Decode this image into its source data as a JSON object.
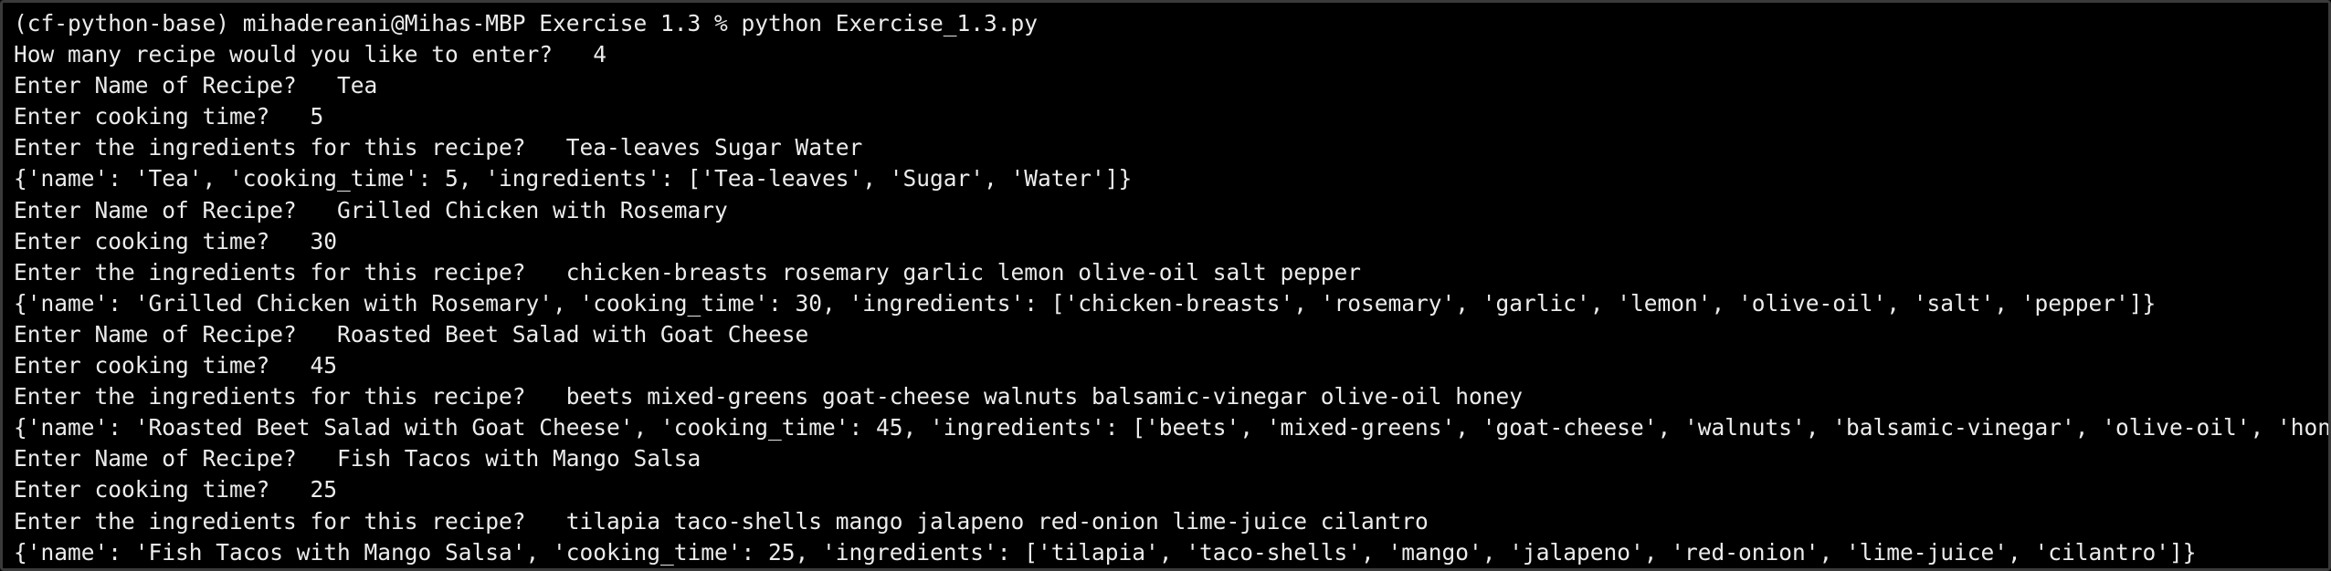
{
  "terminal": {
    "colors": {
      "background": "#000000",
      "foreground": "#ececec",
      "border": "#3a3a3a"
    },
    "lines": [
      "(cf-python-base) mihadereani@Mihas-MBP Exercise 1.3 % python Exercise_1.3.py",
      "How many recipe would you like to enter?   4",
      "Enter Name of Recipe?   Tea",
      "Enter cooking time?   5",
      "Enter the ingredients for this recipe?   Tea-leaves Sugar Water",
      "{'name': 'Tea', 'cooking_time': 5, 'ingredients': ['Tea-leaves', 'Sugar', 'Water']}",
      "Enter Name of Recipe?   Grilled Chicken with Rosemary",
      "Enter cooking time?   30",
      "Enter the ingredients for this recipe?   chicken-breasts rosemary garlic lemon olive-oil salt pepper",
      "{'name': 'Grilled Chicken with Rosemary', 'cooking_time': 30, 'ingredients': ['chicken-breasts', 'rosemary', 'garlic', 'lemon', 'olive-oil', 'salt', 'pepper']}",
      "Enter Name of Recipe?   Roasted Beet Salad with Goat Cheese",
      "Enter cooking time?   45",
      "Enter the ingredients for this recipe?   beets mixed-greens goat-cheese walnuts balsamic-vinegar olive-oil honey",
      "{'name': 'Roasted Beet Salad with Goat Cheese', 'cooking_time': 45, 'ingredients': ['beets', 'mixed-greens', 'goat-cheese', 'walnuts', 'balsamic-vinegar', 'olive-oil', 'honey']}",
      "Enter Name of Recipe?   Fish Tacos with Mango Salsa",
      "Enter cooking time?   25",
      "Enter the ingredients for this recipe?   tilapia taco-shells mango jalapeno red-onion lime-juice cilantro",
      "{'name': 'Fish Tacos with Mango Salsa', 'cooking_time': 25, 'ingredients': ['tilapia', 'taco-shells', 'mango', 'jalapeno', 'red-onion', 'lime-juice', 'cilantro']}"
    ]
  }
}
